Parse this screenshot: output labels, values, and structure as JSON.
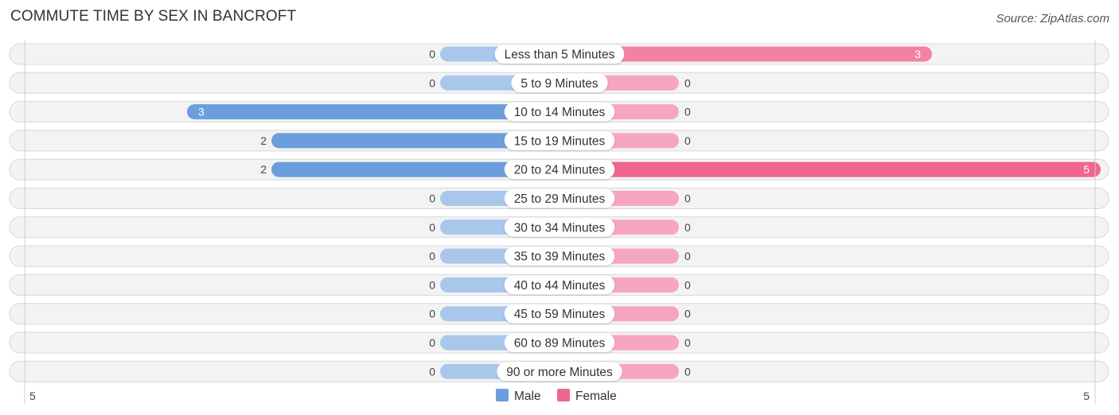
{
  "header": {
    "title": "COMMUTE TIME BY SEX IN BANCROFT",
    "source": "Source: ZipAtlas.com"
  },
  "colors": {
    "male": "#6a9fdc",
    "male_light": "#a9c7eb",
    "female": "#f0668f",
    "female_light": "#f7a6bf",
    "female_mid": "#f381a3"
  },
  "chart_data": {
    "type": "bar",
    "orientation": "horizontal-diverging",
    "title": "COMMUTE TIME BY SEX IN BANCROFT",
    "categories": [
      "Less than 5 Minutes",
      "5 to 9 Minutes",
      "10 to 14 Minutes",
      "15 to 19 Minutes",
      "20 to 24 Minutes",
      "25 to 29 Minutes",
      "30 to 34 Minutes",
      "35 to 39 Minutes",
      "40 to 44 Minutes",
      "45 to 59 Minutes",
      "60 to 89 Minutes",
      "90 or more Minutes"
    ],
    "series": [
      {
        "name": "Male",
        "values": [
          0,
          0,
          3,
          2,
          2,
          0,
          0,
          0,
          0,
          0,
          0,
          0
        ]
      },
      {
        "name": "Female",
        "values": [
          3,
          0,
          0,
          0,
          5,
          0,
          0,
          0,
          0,
          0,
          0,
          0
        ]
      }
    ],
    "axis": {
      "left_tick": "5",
      "right_tick": "5",
      "max": 5
    },
    "legend": {
      "position": "bottom-center",
      "items": [
        "Male",
        "Female"
      ]
    },
    "xlabel": "",
    "ylabel": ""
  }
}
